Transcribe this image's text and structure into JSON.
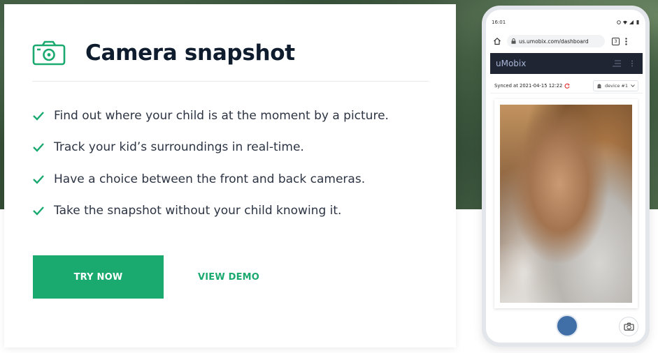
{
  "feature_card": {
    "title": "Camera snapshot",
    "icon": "camera-icon",
    "features": [
      "Find out where your child is at the moment by a picture.",
      "Track your kid’s surroundings in real-time.",
      "Have a choice between the front and back cameras.",
      "Take the snapshot without your child knowing it."
    ],
    "try_now_label": "TRY NOW",
    "view_demo_label": "VIEW DEMO"
  },
  "phone": {
    "status_time": "16:01",
    "url": "us.umobix.com/dashboard",
    "tab_count": "3",
    "brand": "uMobix",
    "synced_text": "Synced at 2021-04-15 12:22",
    "device_label": "device #1"
  },
  "colors": {
    "accent": "#1aa96f",
    "title": "#0f1c2e",
    "body_text": "#2c3443",
    "app_header": "#1f2533",
    "shutter": "#3f6fa6"
  }
}
